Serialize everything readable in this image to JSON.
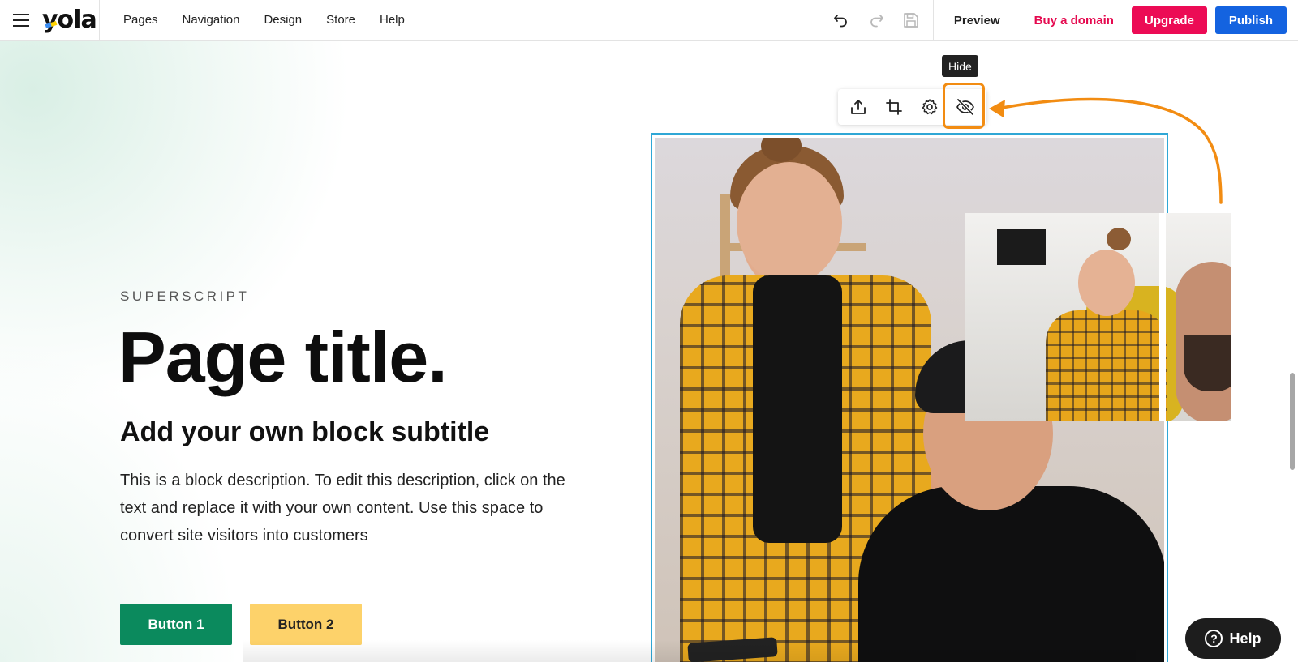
{
  "topbar": {
    "logo_text": "yola",
    "nav": [
      "Pages",
      "Navigation",
      "Design",
      "Store",
      "Help"
    ],
    "preview_label": "Preview",
    "domain_label": "Buy a domain",
    "upgrade_label": "Upgrade",
    "publish_label": "Publish",
    "colors": {
      "upgrade_bg": "#ec0b55",
      "publish_bg": "#1463e0",
      "domain_text": "#e5094f"
    }
  },
  "tools": {
    "icons": [
      "undo-icon",
      "redo-icon",
      "save-icon"
    ]
  },
  "image_toolbar": {
    "tooltip": "Hide",
    "icons": [
      "upload-icon",
      "crop-icon",
      "gear-icon",
      "eye-slash-icon"
    ],
    "highlight_color": "#f28c12"
  },
  "block": {
    "superscript": "SUPERSCRIPT",
    "title": "Page title.",
    "subtitle": "Add your own block subtitle",
    "description": "This is a block description. To edit this description, click on the text and replace it with your own content. Use this space to convert site visitors into customers",
    "button1": "Button 1",
    "button2": "Button 2",
    "colors": {
      "button1_bg": "#0b8a5d",
      "button2_bg": "#fdd26a",
      "selection_frame": "#2fa7d6"
    }
  },
  "help": {
    "label": "Help",
    "icon": "question-mark-icon"
  }
}
